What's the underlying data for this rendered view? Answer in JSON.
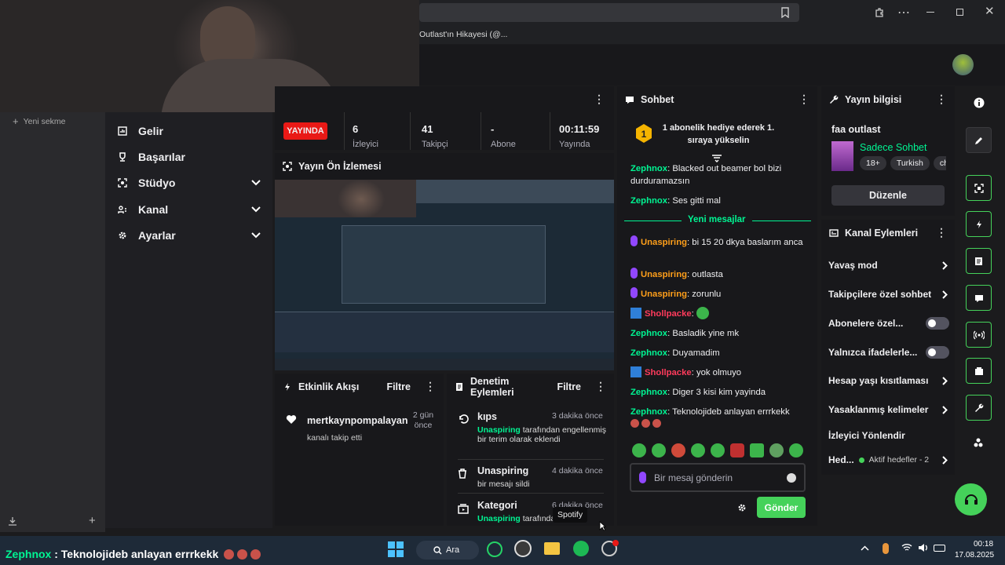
{
  "browser": {
    "tab_title": "Outlast'ın Hikayesi (@...",
    "new_tab": "Yeni sekme"
  },
  "nav": {
    "items": [
      {
        "label": "Gelir"
      },
      {
        "label": "Başarılar"
      },
      {
        "label": "Stüdyo"
      },
      {
        "label": "Kanal"
      },
      {
        "label": "Ayarlar"
      }
    ]
  },
  "stats": {
    "live_badge": "YAYINDA",
    "items": [
      {
        "value": "6",
        "label": "İzleyici"
      },
      {
        "value": "41",
        "label": "Takipçi"
      },
      {
        "value": "-",
        "label": "Abone"
      },
      {
        "value": "00:11:59",
        "label": "Yayında"
      }
    ]
  },
  "preview": {
    "title": "Yayın Ön İzlemesi"
  },
  "activity": {
    "title": "Etkinlik Akışı",
    "filter": "Filtre",
    "item": {
      "name": "mertkaynpompalayan",
      "action": "kanalı takip etti",
      "time": "2 gün önce"
    }
  },
  "mod": {
    "title": "Denetim Eylemleri",
    "filter": "Filtre",
    "items": [
      {
        "title": "kıps",
        "time": "3 dakika önce",
        "actor": "Unaspiring",
        "desc": "tarafından engellenmiş bir terim olarak eklendi"
      },
      {
        "title": "Unaspiring",
        "time": "4 dakika önce",
        "desc": "bir mesajı sildi"
      },
      {
        "title": "Kategori",
        "time": "6 dakika önce",
        "actor": "Unaspiring",
        "desc": "tarafından"
      }
    ]
  },
  "tooltip": "Spotify",
  "chat": {
    "title": "Sohbet",
    "promo": "1 abonelik hediye ederek 1. sıraya yükselin",
    "new_messages": "Yeni mesajlar",
    "messages": [
      {
        "user": "Zephnox",
        "text": "Blacked out beamer bol bizi durduramazsın"
      },
      {
        "user": "Zephnox",
        "text": "Ses gitti mal"
      },
      {
        "user": "Unaspiring",
        "text": "bi 15 20 dkya baslarım anca"
      },
      {
        "user": "Unaspiring",
        "text": "outlasta"
      },
      {
        "user": "Unaspiring",
        "text": "zorunlu"
      },
      {
        "user": "Shollpacke",
        "text": ""
      },
      {
        "user": "Zephnox",
        "text": "Basladik yine mk"
      },
      {
        "user": "Zephnox",
        "text": "Duyamadim"
      },
      {
        "user": "Shollpacke",
        "text": "yok olmuyo"
      },
      {
        "user": "Zephnox",
        "text": "Diger 3 kisi kim yayinda"
      },
      {
        "user": "Zephnox",
        "text": "Teknolojideb anlayan errrkekk"
      }
    ],
    "placeholder": "Bir mesaj gönderin",
    "send": "Gönder"
  },
  "info": {
    "title": "Yayın bilgisi",
    "stream_title": "faa outlast",
    "category": "Sadece Sohbet",
    "tags": [
      "18+",
      "Turkish",
      "ch"
    ],
    "edit": "Düzenle"
  },
  "channel": {
    "title": "Kanal Eylemleri",
    "items": [
      "Yavaş mod",
      "Takipçilere özel sohbet",
      "Abonelere özel...",
      "Yalnızca ifadelerle...",
      "Hesap yaşı kısıtlaması",
      "Yasaklanmış kelimeler",
      "İzleyici Yönlendir",
      "Hed..."
    ],
    "goals": "Aktif hedefler - 2"
  },
  "taskbar": {
    "ticker_user": "Zephnox",
    "ticker_text": "Teknolojideb anlayan errrkekk",
    "search": "Ara",
    "time": "00:18",
    "date": "17.08.2025"
  },
  "colors": {
    "twitch_green": "#00f593",
    "live_red": "#e91916",
    "chat_purple": "#9147ff",
    "shollpacke_red": "#ff3b5c",
    "send_green": "#45d25a"
  }
}
